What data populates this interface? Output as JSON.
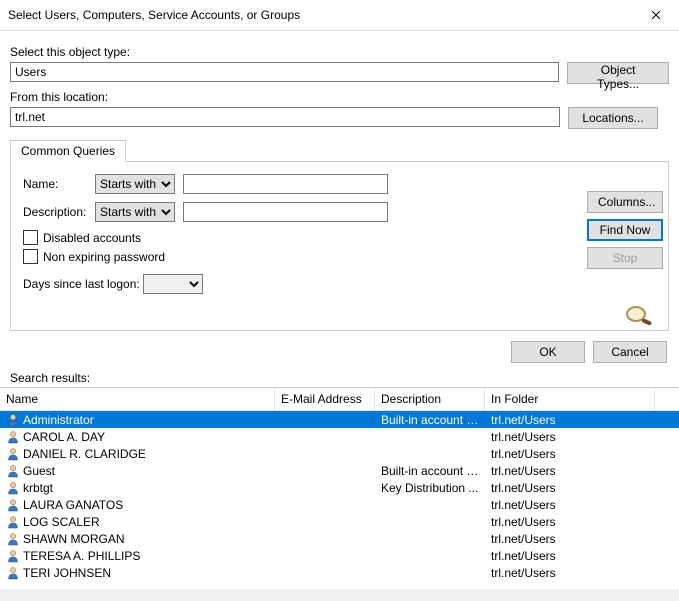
{
  "title": "Select Users, Computers, Service Accounts, or Groups",
  "labels": {
    "object_type": "Select this object type:",
    "location": "From this location:",
    "tab": "Common Queries",
    "name": "Name:",
    "description": "Description:",
    "disabled": "Disabled accounts",
    "nonexpire": "Non expiring password",
    "days": "Days since last logon:",
    "results": "Search results:"
  },
  "values": {
    "object_type": "Users",
    "location": "trl.net",
    "name_mode": "Starts with",
    "desc_mode": "Starts with",
    "name_input": "",
    "desc_input": "",
    "days_value": ""
  },
  "buttons": {
    "object_types": "Object Types...",
    "locations": "Locations...",
    "columns": "Columns...",
    "find_now": "Find Now",
    "stop": "Stop",
    "ok": "OK",
    "cancel": "Cancel"
  },
  "columns": {
    "name": "Name",
    "email": "E-Mail Address",
    "desc": "Description",
    "folder": "In Folder"
  },
  "rows": [
    {
      "name": "Administrator",
      "email": "",
      "desc": "Built-in account f...",
      "folder": "trl.net/Users",
      "selected": true
    },
    {
      "name": "CAROL A. DAY",
      "email": "",
      "desc": "",
      "folder": "trl.net/Users",
      "selected": false
    },
    {
      "name": "DANIEL R. CLARIDGE",
      "email": "",
      "desc": "",
      "folder": "trl.net/Users",
      "selected": false
    },
    {
      "name": "Guest",
      "email": "",
      "desc": "Built-in account f...",
      "folder": "trl.net/Users",
      "selected": false
    },
    {
      "name": "krbtgt",
      "email": "",
      "desc": "Key Distribution ...",
      "folder": "trl.net/Users",
      "selected": false
    },
    {
      "name": "LAURA GANATOS",
      "email": "",
      "desc": "",
      "folder": "trl.net/Users",
      "selected": false
    },
    {
      "name": "LOG SCALER",
      "email": "",
      "desc": "",
      "folder": "trl.net/Users",
      "selected": false
    },
    {
      "name": "SHAWN MORGAN",
      "email": "",
      "desc": "",
      "folder": "trl.net/Users",
      "selected": false
    },
    {
      "name": "TERESA A. PHILLIPS",
      "email": "",
      "desc": "",
      "folder": "trl.net/Users",
      "selected": false
    },
    {
      "name": "TERI JOHNSEN",
      "email": "",
      "desc": "",
      "folder": "trl.net/Users",
      "selected": false
    }
  ]
}
